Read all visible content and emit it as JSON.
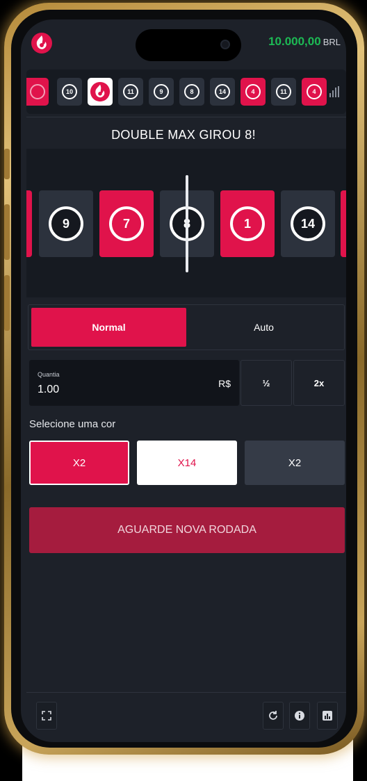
{
  "header": {
    "balance": "10.000,00",
    "currency": "BRL"
  },
  "history": [
    {
      "color": "red",
      "value": ""
    },
    {
      "color": "black",
      "value": "10"
    },
    {
      "color": "white",
      "value": ""
    },
    {
      "color": "black",
      "value": "11"
    },
    {
      "color": "black",
      "value": "9"
    },
    {
      "color": "black",
      "value": "8"
    },
    {
      "color": "black",
      "value": "14"
    },
    {
      "color": "red",
      "value": "4"
    },
    {
      "color": "black",
      "value": "11"
    },
    {
      "color": "red",
      "value": "4"
    }
  ],
  "status_message": "DOUBLE MAX GIROU 8!",
  "roll": {
    "tiles": [
      {
        "color": "black",
        "value": "9"
      },
      {
        "color": "red",
        "value": "7"
      },
      {
        "color": "black",
        "value": "8"
      },
      {
        "color": "red",
        "value": "1"
      },
      {
        "color": "black",
        "value": "14"
      }
    ]
  },
  "modes": {
    "normal": "Normal",
    "auto": "Auto"
  },
  "bet": {
    "label": "Quantia",
    "value": "1.00",
    "currency": "R$",
    "half": "½",
    "double": "2x"
  },
  "color_pick": {
    "label": "Selecione uma cor",
    "red": "X2",
    "white": "X14",
    "black": "X2"
  },
  "cta": "AGUARDE NOVA RODADA",
  "colors": {
    "red": "#e0134b",
    "black": "#2c323d",
    "white": "#ffffff",
    "balance_green": "#1db954",
    "cta": "#a51c3e",
    "background": "#1d2129"
  },
  "icons": {
    "logo": "flame-logo-icon",
    "stats": "bar-chart-icon",
    "fullscreen": "fullscreen-icon",
    "refresh": "refresh-icon",
    "info": "info-icon",
    "chart": "chart-icon"
  }
}
